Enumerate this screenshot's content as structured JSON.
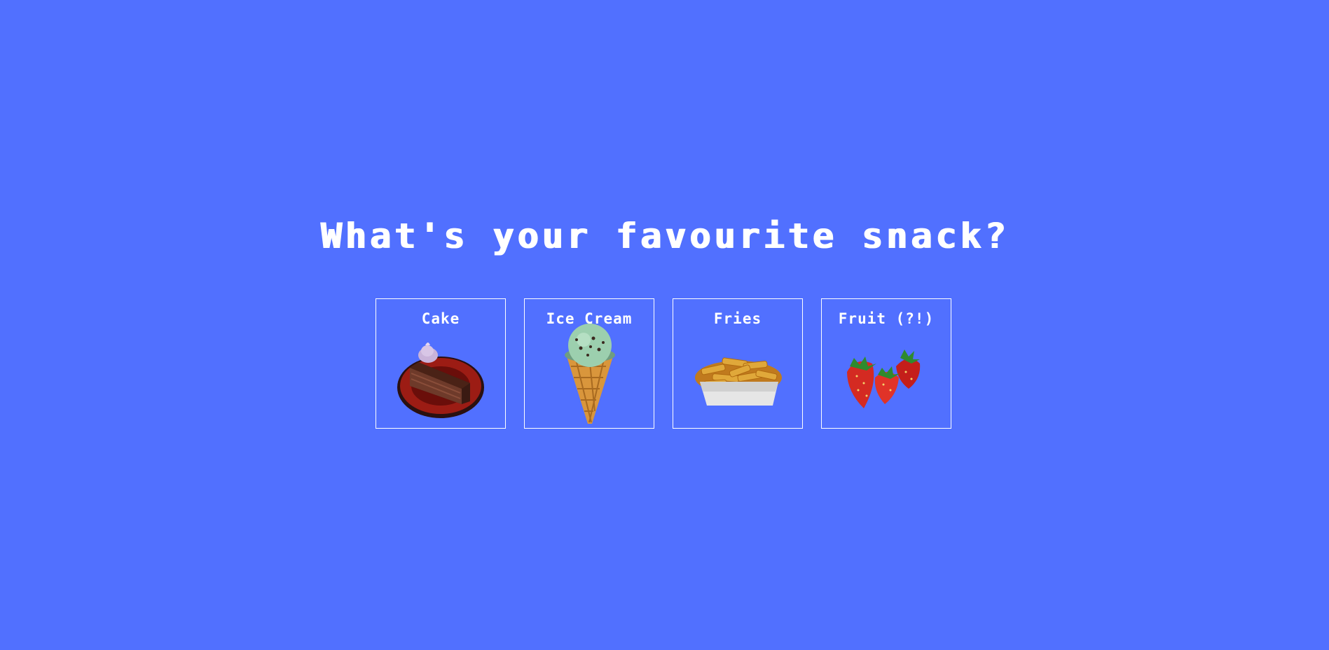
{
  "page": {
    "title": "What's your favourite snack?",
    "background_color": "#5170ff"
  },
  "options": [
    {
      "label": "Cake",
      "icon": "cake-slice-icon"
    },
    {
      "label": "Ice Cream",
      "icon": "ice-cream-cone-icon"
    },
    {
      "label": "Fries",
      "icon": "fries-icon"
    },
    {
      "label": "Fruit (?!)",
      "icon": "strawberries-icon"
    }
  ]
}
